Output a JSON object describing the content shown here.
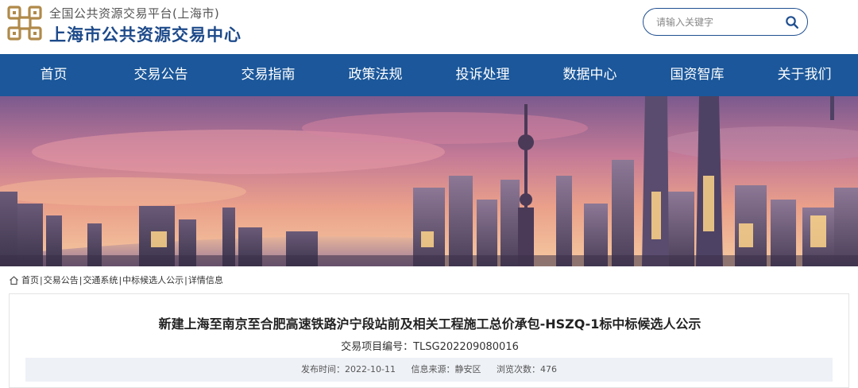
{
  "header": {
    "subtitle": "全国公共资源交易平台(上海市)",
    "title": "上海市公共资源交易中心"
  },
  "search": {
    "placeholder": "请输入关键字"
  },
  "nav": {
    "items": [
      "首页",
      "交易公告",
      "交易指南",
      "政策法规",
      "投诉处理",
      "数据中心",
      "国资智库",
      "关于我们"
    ]
  },
  "breadcrumb": {
    "items": [
      "首页",
      "交易公告",
      "交通系统",
      "中标候选人公示",
      "详情信息"
    ]
  },
  "detail": {
    "title": "新建上海至南京至合肥高速铁路沪宁段站前及相关工程施工总价承包-HSZQ-1标中标候选人公示",
    "project_no": "交易项目编号：TLSG202209080016",
    "publish_time": "发布时间：2022-10-11",
    "source": "信息来源：静安区",
    "views": "浏览次数：476"
  },
  "colors": {
    "nav_bg": "#1b579a",
    "title_blue": "#1d4a8a",
    "logo_gold": "#b08a4a"
  }
}
